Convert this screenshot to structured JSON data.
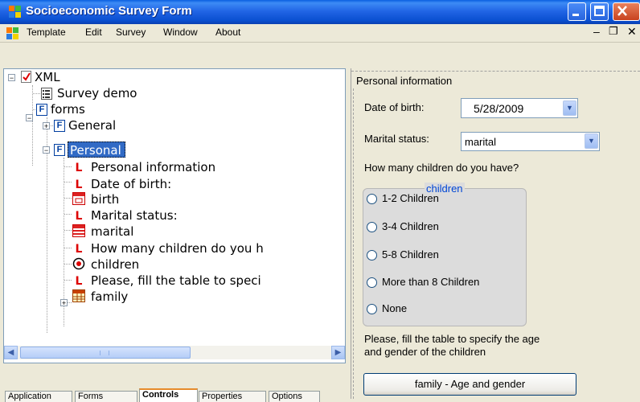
{
  "window": {
    "title": "Socioeconomic Survey Form"
  },
  "menu": {
    "items": [
      "Template",
      "Edit",
      "Survey",
      "Window",
      "About"
    ]
  },
  "tree": {
    "root": "XML",
    "survey_demo": "Survey demo",
    "forms": "forms",
    "general": "General",
    "personal": "Personal",
    "children_nodes": [
      "Personal information",
      "Date of birth:",
      "birth",
      "Marital status:",
      "marital",
      "How many children do you h",
      "children",
      "Please, fill the table to speci",
      "family"
    ]
  },
  "tabs": [
    "Application",
    "Forms",
    "Controls",
    "Properties",
    "Options"
  ],
  "panel": {
    "header": "Personal information",
    "dob_label": "Date of birth:",
    "dob_value": "5/28/2009",
    "marital_label": "Marital status:",
    "marital_value": "marital",
    "children_question": "How many children do you have?",
    "group_title": "children",
    "radio_options": [
      "1-2 Children",
      "3-4 Children",
      "5-8 Children",
      "More than 8 Children",
      "None"
    ],
    "table_prompt_line1": "Please, fill the table to specify the age",
    "table_prompt_line2": "and gender of the children",
    "family_button": "family - Age and gender"
  },
  "colors": {
    "titlebar": "#2266e6",
    "selection": "#316ac5",
    "group_title": "#0046d5"
  }
}
